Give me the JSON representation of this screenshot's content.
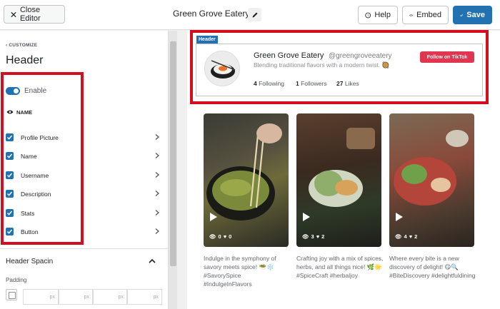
{
  "topbar": {
    "close_label": "Close Editor",
    "feed_title": "Green Grove Eatery",
    "help_label": "Help",
    "embed_label": "Embed",
    "save_label": "Save"
  },
  "sidebar": {
    "breadcrumb": "CUSTOMIZE",
    "title": "Header",
    "enable_label": "Enable",
    "name_label": "NAME",
    "options": [
      "Profile Picture",
      "Name",
      "Username",
      "Description",
      "Stats",
      "Button"
    ],
    "spacing_title": "Header Spacin",
    "padding_label": "Padding",
    "padding_unit": "px"
  },
  "preview": {
    "header_tag": "Header",
    "profile": {
      "name": "Green Grove Eatery",
      "handle": "@greengroveeatery",
      "bio": "Blending traditional flavors with a modern twist. 🥘",
      "following_count": "4",
      "following_label": "Following",
      "followers_count": "1",
      "followers_label": "Followers",
      "likes_count": "27",
      "likes_label": "Likes",
      "follow_button": "Follow on TikTok"
    },
    "videos": [
      {
        "views": "0",
        "likes": "0",
        "caption": "Indulge in the symphony of savory meets spice! 🥗❄️ #SavorySpice #IndulgeInFlavors"
      },
      {
        "views": "3",
        "likes": "2",
        "caption": "Crafting joy with a mix of spices, herbs, and all things nice! 🌿🌟 #SpiceCraft #herbaljoy"
      },
      {
        "views": "4",
        "likes": "2",
        "caption": "Where every bite is a new discovery of delight! 😋🔍 #BiteDiscovery #delightfuldining"
      }
    ]
  },
  "colors": {
    "accent": "#2271b1",
    "highlight": "#d20f1f",
    "tiktok": "#e0374f"
  }
}
